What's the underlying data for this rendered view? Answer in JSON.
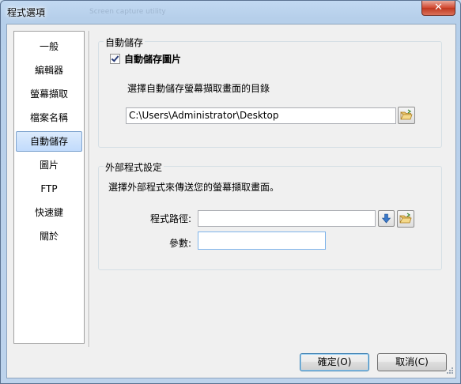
{
  "window": {
    "title": "程式選項",
    "ghost_title": "Screen capture utility",
    "close_glyph": "✕"
  },
  "sidebar": {
    "items": [
      {
        "label": "一般",
        "selected": false
      },
      {
        "label": "編輯器",
        "selected": false
      },
      {
        "label": "螢幕擷取",
        "selected": false
      },
      {
        "label": "檔案名稱",
        "selected": false
      },
      {
        "label": "自動儲存",
        "selected": true
      },
      {
        "label": "圖片",
        "selected": false
      },
      {
        "label": "FTP",
        "selected": false
      },
      {
        "label": "快速鍵",
        "selected": false
      },
      {
        "label": "關於",
        "selected": false
      }
    ]
  },
  "autosave": {
    "group_title": "自動儲存",
    "checkbox_label": "自動儲存圖片",
    "checked": true,
    "folder_prompt": "選擇自動儲存螢幕擷取畫面的目錄",
    "folder_path": "C:\\Users\\Administrator\\Desktop",
    "browse_icon": "folder-open-icon"
  },
  "external": {
    "group_title": "外部程式設定",
    "description": "選擇外部程式來傳送您的螢幕擷取畫面。",
    "path_label": "程式路徑:",
    "path_value": "",
    "args_label": "參數:",
    "args_value": "",
    "dropdown_icon": "down-arrow-icon",
    "browse_icon": "folder-open-icon"
  },
  "buttons": {
    "ok": "確定(O)",
    "cancel": "取消(C)"
  },
  "colors": {
    "accent": "#3c7fb1",
    "selection": "#c1dbfc",
    "close": "#c0381f"
  }
}
